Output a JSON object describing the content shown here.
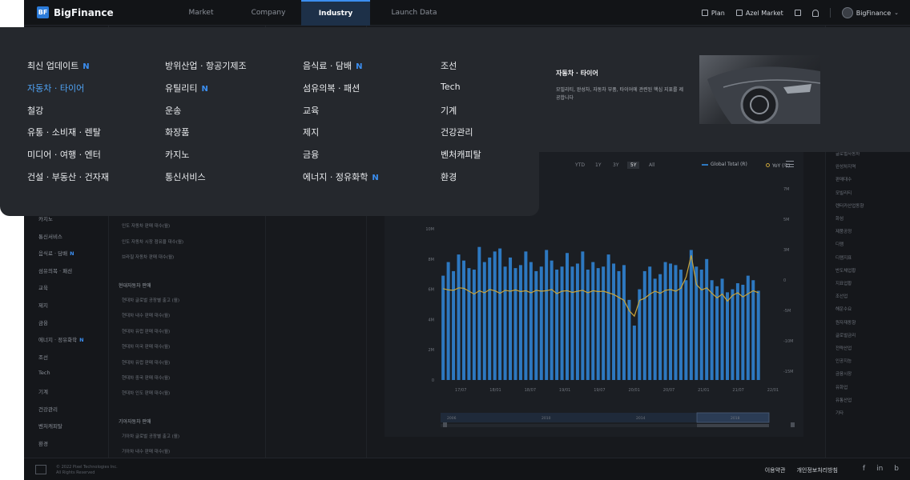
{
  "app": {
    "name": "BigFinance",
    "logo_mark": "BF"
  },
  "topnav": {
    "tabs": [
      {
        "label": "Market",
        "active": false
      },
      {
        "label": "Company",
        "active": false
      },
      {
        "label": "Industry",
        "active": true
      },
      {
        "label": "Launch Data",
        "active": false
      }
    ],
    "plan_label": "Plan",
    "azel_label": "Azel Market",
    "user_label": "BigFinance"
  },
  "megamenu": {
    "columns": [
      [
        {
          "label": "최신 업데이트",
          "new": true,
          "active": false
        },
        {
          "label": "자동차 · 타이어",
          "new": false,
          "active": true
        },
        {
          "label": "철강",
          "new": false,
          "active": false
        },
        {
          "label": "유통 · 소비재 · 렌탈",
          "new": false,
          "active": false
        },
        {
          "label": "미디어 · 여행 · 엔터",
          "new": false,
          "active": false
        },
        {
          "label": "건설 · 부동산 · 건자재",
          "new": false,
          "active": false
        }
      ],
      [
        {
          "label": "방위산업 · 항공기제조",
          "new": false,
          "active": false
        },
        {
          "label": "유틸리티",
          "new": true,
          "active": false
        },
        {
          "label": "운송",
          "new": false,
          "active": false
        },
        {
          "label": "화장품",
          "new": false,
          "active": false
        },
        {
          "label": "카지노",
          "new": false,
          "active": false
        },
        {
          "label": "통신서비스",
          "new": false,
          "active": false
        }
      ],
      [
        {
          "label": "음식료 · 담배",
          "new": true,
          "active": false
        },
        {
          "label": "섬유의복 · 패션",
          "new": false,
          "active": false
        },
        {
          "label": "교육",
          "new": false,
          "active": false
        },
        {
          "label": "제지",
          "new": false,
          "active": false
        },
        {
          "label": "금융",
          "new": false,
          "active": false
        },
        {
          "label": "에너지 · 정유화학",
          "new": true,
          "active": false
        }
      ],
      [
        {
          "label": "조선",
          "new": false,
          "active": false
        },
        {
          "label": "Tech",
          "new": false,
          "active": false
        },
        {
          "label": "기계",
          "new": false,
          "active": false
        },
        {
          "label": "건강관리",
          "new": false,
          "active": false
        },
        {
          "label": "벤처캐피탈",
          "new": false,
          "active": false
        },
        {
          "label": "환경",
          "new": false,
          "active": false
        }
      ]
    ],
    "new_badge": "N",
    "promo": {
      "title": "자동차 · 타이어",
      "description": "모빌리티, 완성차, 자동차 부품, 타이어에 관련된 핵심 지표를 제공합니다"
    }
  },
  "left_sidebar": {
    "items": [
      {
        "label": "카지노",
        "new": false
      },
      {
        "label": "통신서비스",
        "new": false
      },
      {
        "label": "음식료 · 담배",
        "new": true
      },
      {
        "label": "섬유의복 · 패션",
        "new": false
      },
      {
        "label": "교육",
        "new": false
      },
      {
        "label": "제지",
        "new": false
      },
      {
        "label": "금융",
        "new": false
      },
      {
        "label": "에너지 · 정유화학",
        "new": true
      },
      {
        "label": "조선",
        "new": false
      },
      {
        "label": "Tech",
        "new": false
      },
      {
        "label": "기계",
        "new": false
      },
      {
        "label": "건강관리",
        "new": false
      },
      {
        "label": "벤처캐피탈",
        "new": false
      },
      {
        "label": "환경",
        "new": false
      }
    ]
  },
  "col2": {
    "top_items": [
      "인도 자동차 판매 대수(월)",
      "인도 자동차 시장 점유율 대수(월)",
      "브라질 자동차 판매 대수(월)"
    ],
    "group1_title": "현대자동차 판매",
    "group1_items": [
      "현대차 글로벌 공장별 출고 (월)",
      "현대차 내수 판매 대수(월)",
      "현대차 유럽 판매 대수(월)",
      "현대차 미국 판매 대수(월)",
      "현대차 유럽 판매 대수(월)",
      "현대차 중국 판매 대수(월)",
      "현대차 인도 판매 대수(월)"
    ],
    "group2_title": "기아자동차 판매",
    "group2_items": [
      "기아차 글로벌 공장별 출고 (월)",
      "기아차 내수 판매 대수(월)"
    ]
  },
  "chart": {
    "range_buttons": [
      {
        "label": "YTD",
        "selected": false
      },
      {
        "label": "1Y",
        "selected": false
      },
      {
        "label": "3Y",
        "selected": false
      },
      {
        "label": "5Y",
        "selected": true
      },
      {
        "label": "All",
        "selected": false
      }
    ],
    "legend": [
      {
        "name": "Global Total (R)",
        "color": "#2d78c0"
      },
      {
        "name": "YoY (우)",
        "color": "#c9a43a"
      }
    ],
    "navigator_labels": [
      "2006",
      "2010",
      "2014",
      "2018"
    ]
  },
  "chart_data": {
    "type": "bar",
    "title": "",
    "x_tick_labels": [
      "17/07",
      "18/01",
      "18/07",
      "19/01",
      "19/07",
      "20/01",
      "20/07",
      "21/01",
      "21/07",
      "22/01"
    ],
    "y_left_ticks": [
      "10M",
      "8M",
      "6M",
      "4M",
      "2M",
      "0"
    ],
    "y_left_range": [
      0,
      10000000
    ],
    "y_right_ticks": [
      "7M",
      "5M",
      "3M",
      "0",
      "-5M",
      "-10M",
      "-15M"
    ],
    "y_right_range": [
      -15,
      7
    ],
    "series": [
      {
        "name": "Global Total (R)",
        "kind": "bar",
        "color": "#2d78c0",
        "values": [
          6.9,
          7.8,
          7.2,
          8.3,
          7.9,
          7.4,
          7.3,
          8.8,
          7.8,
          8.1,
          8.5,
          8.7,
          7.5,
          8.1,
          7.4,
          7.6,
          8.5,
          7.8,
          7.2,
          7.5,
          8.6,
          7.9,
          7.3,
          7.5,
          8.4,
          7.5,
          7.7,
          8.5,
          7.3,
          7.8,
          7.4,
          7.5,
          8.3,
          7.7,
          7.2,
          7.6,
          5.3,
          3.6,
          6.0,
          7.2,
          7.5,
          6.7,
          7.0,
          7.8,
          7.7,
          7.6,
          7.3,
          6.6,
          8.6,
          7.5,
          7.3,
          8.0,
          6.6,
          6.2,
          6.7,
          5.8,
          6.0,
          6.4,
          6.3,
          6.9,
          6.6,
          5.9
        ]
      },
      {
        "name": "YoY (우)",
        "kind": "line",
        "color": "#c9a43a",
        "values": [
          0.8,
          0.5,
          0.4,
          1.0,
          0.9,
          0.2,
          -0.5,
          0.3,
          -0.2,
          0.6,
          0.3,
          -0.3,
          0.4,
          0.2,
          0.5,
          0.1,
          0.3,
          -0.2,
          0.4,
          0.2,
          0.3,
          0.6,
          -0.4,
          0.2,
          0.3,
          -0.1,
          0.2,
          0.4,
          -0.2,
          0.3,
          0.1,
          0.2,
          -0.2,
          -0.6,
          -1.3,
          -2.0,
          -4.5,
          -5.8,
          -2.0,
          -1.5,
          -0.5,
          0.2,
          -0.3,
          0.4,
          0.6,
          0.2,
          0.9,
          3.6,
          8.8,
          1.8,
          0.5,
          1.0,
          -0.3,
          -1.4,
          -0.5,
          -2.2,
          -0.8,
          -0.2,
          -1.2,
          -0.4,
          0.3,
          -0.2
        ]
      }
    ],
    "grid": false,
    "legend_position": "top-right"
  },
  "right_sidebar": {
    "items": [
      "글로벌자동차",
      "완성차지역",
      "판매대수",
      "모빌리티",
      "렌터카산업동향",
      "화섬",
      "제품공정",
      "디램",
      "디램지표",
      "반도체업황",
      "지표업황",
      "조선업",
      "해운수요",
      "원자재동향",
      "글로벌금리",
      "전략산업",
      "인공지능",
      "금융시장",
      "유화업",
      "유통산업",
      "기타"
    ]
  },
  "footer": {
    "copyright_line1": "© 2022 Pixel Technologies Inc.",
    "copyright_line2": "All Rights Reserved",
    "links": [
      "이용약관",
      "개인정보처리방침"
    ],
    "social": [
      "f",
      "in",
      "b"
    ]
  }
}
